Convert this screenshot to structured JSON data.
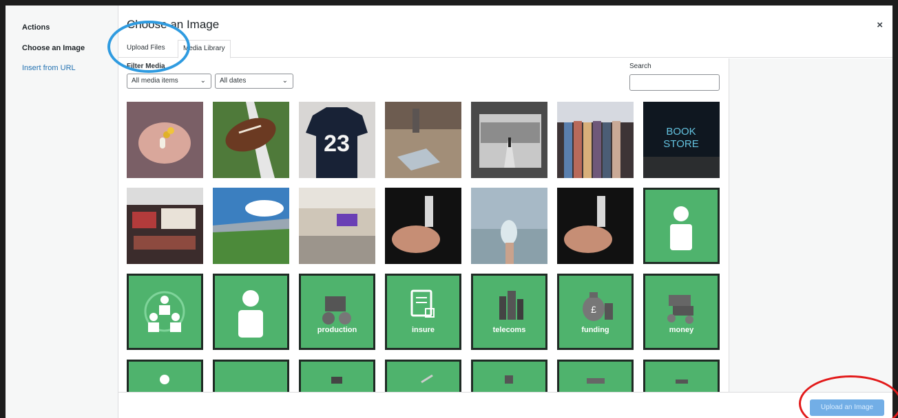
{
  "menu": {
    "heading": "Actions",
    "active": "Choose an Image",
    "link": "Insert from URL"
  },
  "frame": {
    "title": "Choose an Image",
    "close": "×",
    "tabs": [
      "Upload Files",
      "Media Library"
    ]
  },
  "filters": {
    "label": "Filter Media",
    "type_value": "All media items",
    "date_value": "All dates",
    "chevron": "⌄",
    "search_label": "Search"
  },
  "tiles": {
    "production": "production",
    "insure": "insure",
    "telecoms": "telecoms",
    "funding": "funding",
    "money": "money"
  },
  "toolbar": {
    "upload_button": "Upload an Image"
  },
  "colors": {
    "tile_green": "#4fb36d",
    "link_blue": "#2271b1",
    "button_blue": "#72aee6",
    "annotation_blue": "#2f9be0",
    "annotation_red": "#e21a1a"
  }
}
